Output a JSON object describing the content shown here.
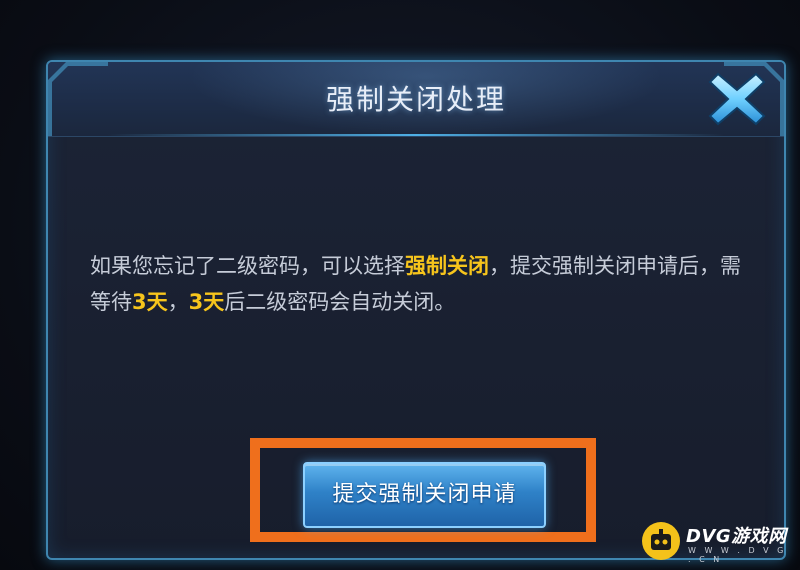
{
  "dialog": {
    "title": "强制关闭处理",
    "close_icon": "close-x-icon",
    "message": {
      "part1": "如果您忘记了二级密码，可以选择",
      "highlight1": "强制关闭",
      "part2": "，提交强制关闭申请后，需等待",
      "highlight2": "3天",
      "part3": "，",
      "highlight3": "3天",
      "part4": "后二级密码会自动关闭。"
    },
    "submit_label": "提交强制关闭申请"
  },
  "watermark": {
    "title": "DVG游戏网",
    "url": "W W W . D V G . C N"
  },
  "colors": {
    "panel_border": "#3f86b0",
    "highlight_text": "#f7c51c",
    "annotation_frame": "#ef6f1c",
    "button_blue": "#2f82c8"
  }
}
